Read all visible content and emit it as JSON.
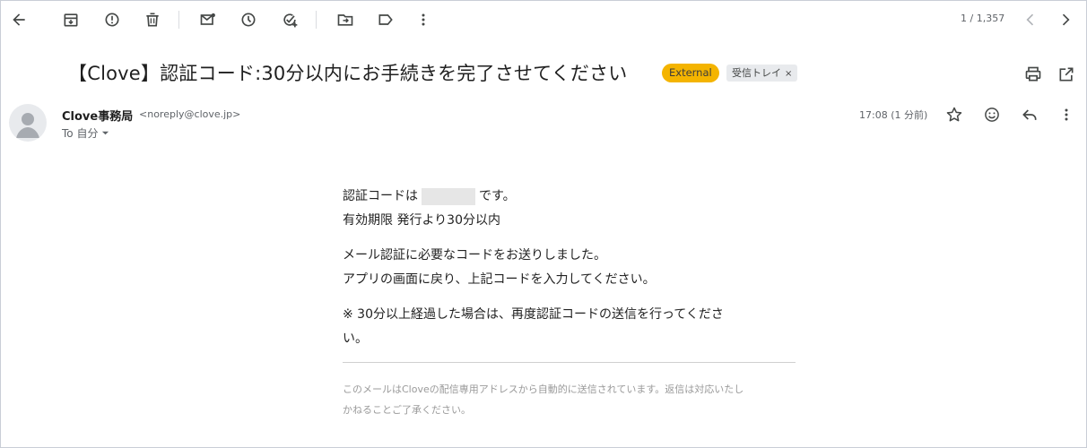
{
  "toolbar": {
    "page_count": "1 / 1,357",
    "buttons": [
      "back-icon",
      "archive-icon",
      "report-spam-icon",
      "delete-icon",
      "mark-unread-icon",
      "snooze-icon",
      "add-task-icon",
      "move-to-icon",
      "label-icon",
      "more-vertical-icon",
      "newer-chevron-icon",
      "older-chevron-icon"
    ]
  },
  "email": {
    "subject": "【Clove】認証コード:30分以内にお手続きを完了させてください",
    "label_external": "External",
    "label_inbox": "受信トレイ",
    "label_inbox_remove": "×",
    "sender_name": "Clove事務局",
    "sender_email": "<noreply@clove.jp>",
    "to": "To 自分",
    "timestamp": "17:08 (1 分前)"
  },
  "body": {
    "line1_prefix": "認証コードは",
    "line1_suffix": "です。",
    "line2": "有効期限 発行より30分以内",
    "line3": "メール認証に必要なコードをお送りしました。",
    "line4": "アプリの画面に戻り、上記コードを入力してください。",
    "line5": "※ 30分以上経過した場合は、再度認証コードの送信を行ってくださ",
    "line6": "い。",
    "footer1": "このメールはCloveの配信専用アドレスから自動的に送信されています。返信は対応いたし",
    "footer2": "かねることご了承ください。"
  },
  "colors": {
    "external_badge": "#f4b400",
    "inbox_badge": "#e8eaed",
    "icon": "#444746"
  }
}
